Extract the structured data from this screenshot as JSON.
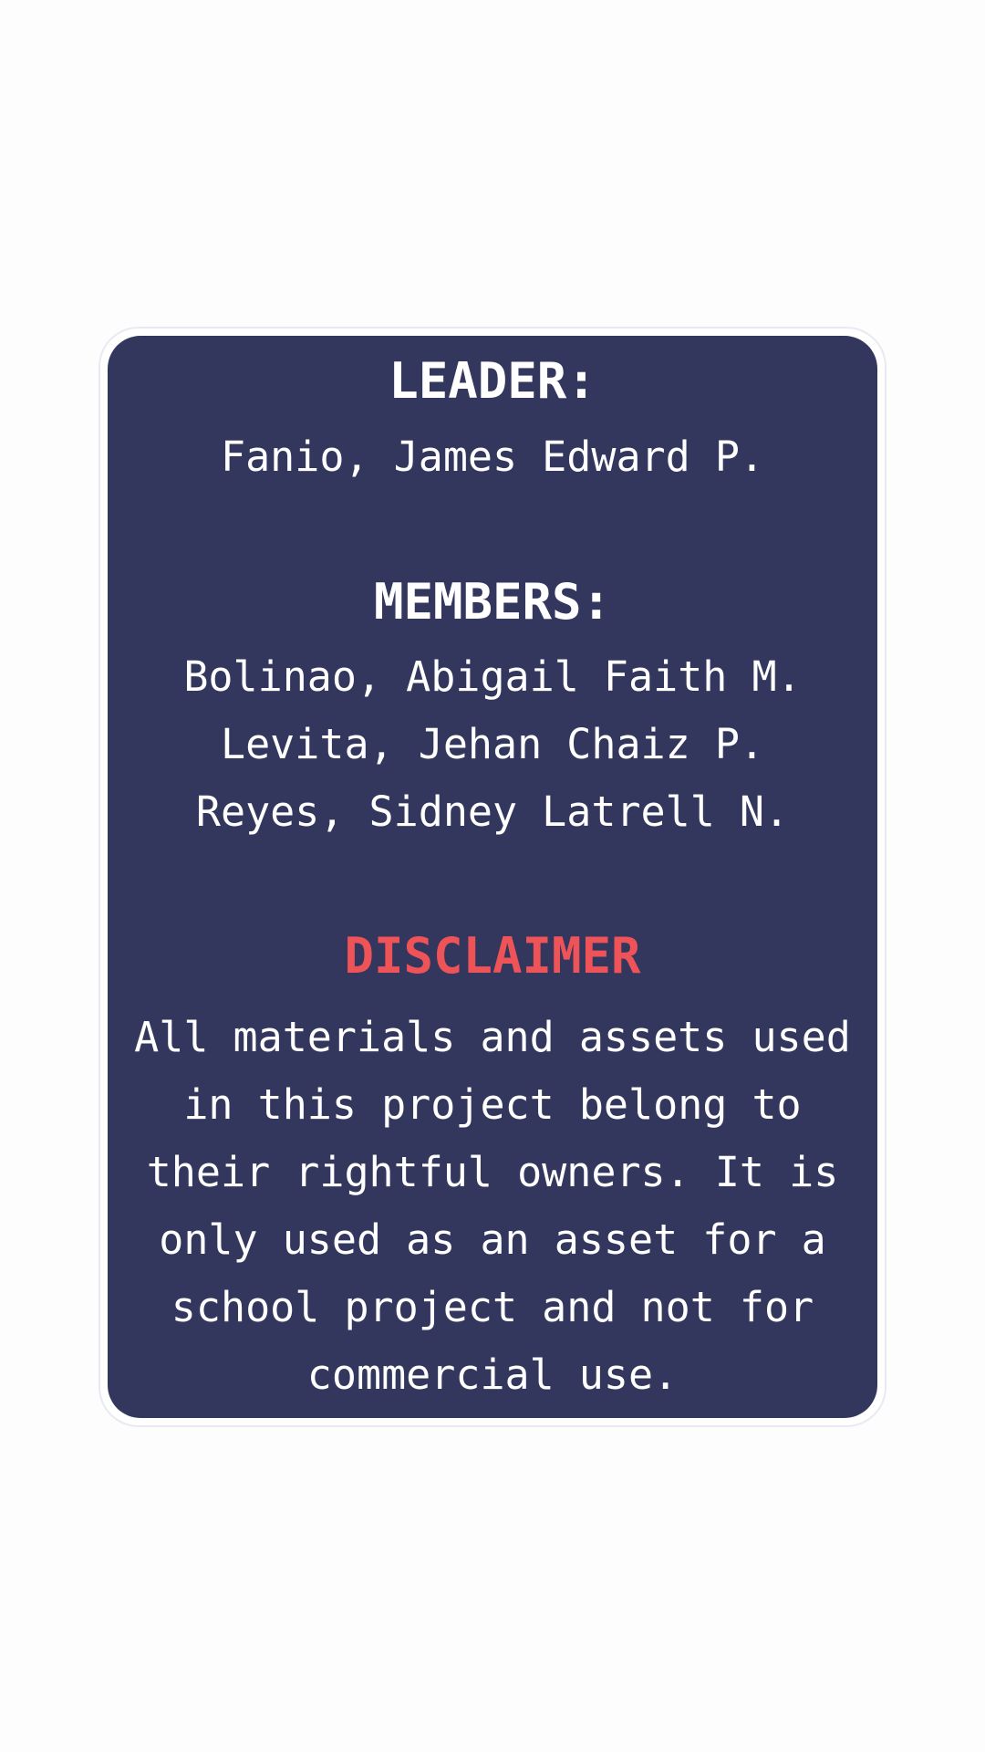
{
  "credits": {
    "leader_heading": "LEADER:",
    "leader_name": "Fanio, James Edward P.",
    "members_heading": "MEMBERS:",
    "members": [
      "Bolinao, Abigail Faith M.",
      "Levita, Jehan Chaiz P.",
      "Reyes, Sidney Latrell N."
    ],
    "disclaimer_heading": "DISCLAIMER",
    "disclaimer_text": "All materials and assets used in this project belong to their rightful owners. It is only used as an asset for a school project and not for commercial use."
  },
  "colors": {
    "background": "#fdfdfd",
    "card": "#33375e",
    "text": "#ffffff",
    "disclaimer_heading": "#ee5358"
  }
}
